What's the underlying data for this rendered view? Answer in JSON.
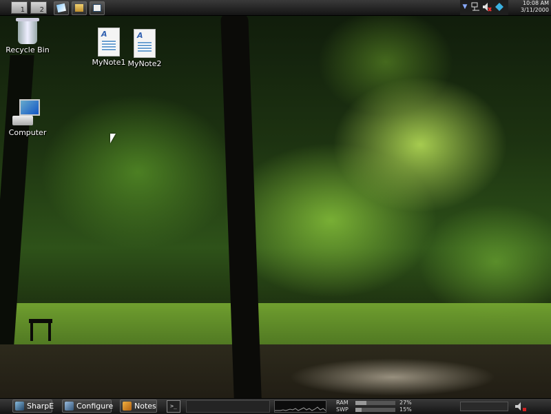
{
  "top_panel": {
    "workspaces": [
      "1",
      "2"
    ],
    "launchers": [
      "notepad-icon",
      "file-manager-icon",
      "window-list-icon"
    ],
    "tray_icons": [
      "menu-arrow-icon",
      "network-icon",
      "volume-muted-icon",
      "app-icon"
    ],
    "clock": {
      "time": "10:08 AM",
      "date": "3/11/2000"
    }
  },
  "desktop": {
    "icons": [
      {
        "label": "Recycle Bin",
        "icon": "recycle-bin-icon"
      },
      {
        "label": "MyNote1",
        "icon": "document-icon"
      },
      {
        "label": "MyNote2",
        "icon": "document-icon"
      },
      {
        "label": "Computer",
        "icon": "computer-icon"
      }
    ]
  },
  "bottom_panel": {
    "tasks": [
      {
        "label": "SharpE",
        "icon": "sharpe-icon"
      },
      {
        "label": "Configure",
        "icon": "configure-icon"
      },
      {
        "label": "Notes",
        "icon": "notes-icon"
      }
    ],
    "terminal_label": ">_",
    "memory": [
      {
        "label": "RAM",
        "percent_text": "27%",
        "fraction": 0.27
      },
      {
        "label": "SWP",
        "percent_text": "15%",
        "fraction": 0.15
      }
    ],
    "volume_icon": "speaker-muted-icon"
  },
  "colors": {
    "panel": "#1e1e1e",
    "accent_blue": "#1356c6",
    "mute_red": "#d02020"
  }
}
